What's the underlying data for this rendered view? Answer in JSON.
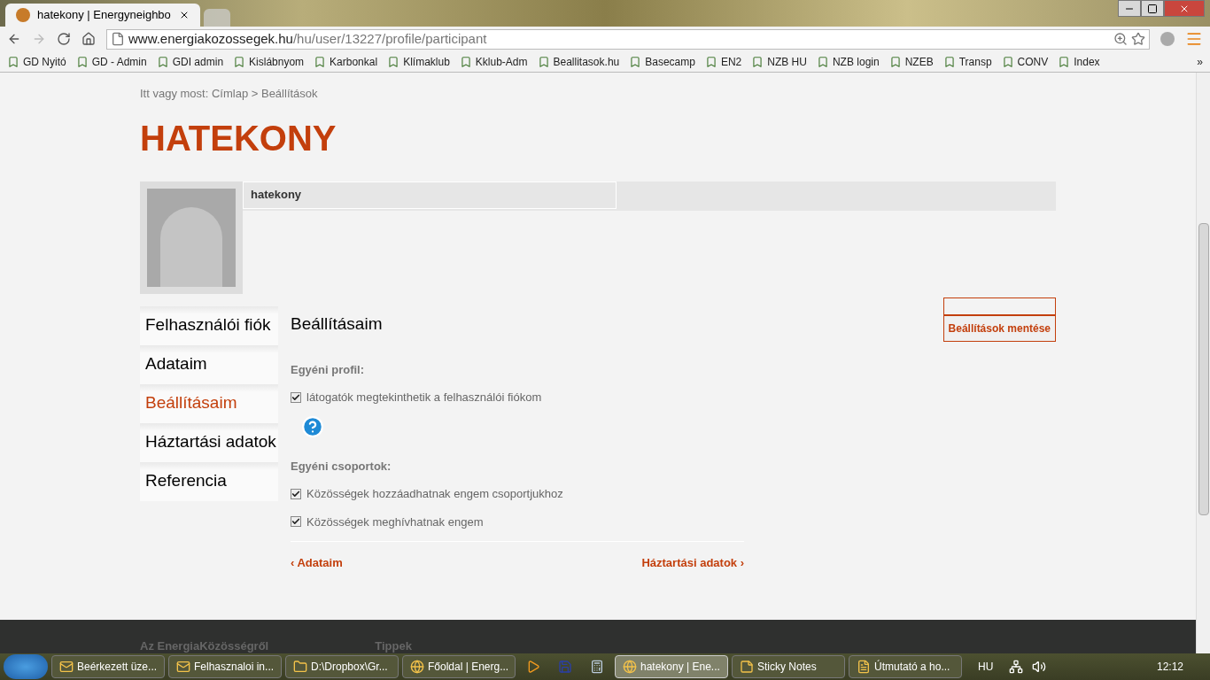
{
  "browser": {
    "tabs": [
      {
        "title": "hatekony | Energyneighbo",
        "selected": true
      },
      {
        "selected": false
      }
    ],
    "url_host": "www.energiakozossegek.hu",
    "url_path": "/hu/user/13227/profile/participant",
    "bookmarks": [
      {
        "label": "GD Nyitó"
      },
      {
        "label": "GD - Admin"
      },
      {
        "label": "GDI admin"
      },
      {
        "label": "Kislábnyom"
      },
      {
        "label": "Karbonkal"
      },
      {
        "label": "Klímaklub"
      },
      {
        "label": "Kklub-Adm"
      },
      {
        "label": "Beallitasok.hu"
      },
      {
        "label": "Basecamp"
      },
      {
        "label": "EN2"
      },
      {
        "label": "NZB HU"
      },
      {
        "label": "NZB login"
      },
      {
        "label": "NZEB"
      },
      {
        "label": "Transp"
      },
      {
        "label": "CONV"
      },
      {
        "label": "Index"
      }
    ],
    "bookmarks_more": "»"
  },
  "breadcrumb": {
    "prefix": "Itt vagy most:",
    "items": [
      "Címlap",
      "Beállítások"
    ],
    "separator": ">"
  },
  "page_title": "HATEKONY",
  "profile": {
    "username": "hatekony"
  },
  "side_menu": [
    {
      "label": "Felhasználói fiók",
      "selected": false
    },
    {
      "label": "Adataim",
      "selected": false
    },
    {
      "label": "Beállításaim",
      "selected": true
    },
    {
      "label": "Háztartási adatok",
      "selected": false
    },
    {
      "label": "Referencia",
      "selected": false
    }
  ],
  "settings": {
    "heading": "Beállításaim",
    "save_button": "Beállítások mentése",
    "sections": [
      {
        "title": "Egyéni profil:",
        "options": [
          {
            "label": "látogatók megtekinthetik a felhasználói fiókom",
            "checked": true
          }
        ],
        "help": true
      },
      {
        "title": "Egyéni csoportok:",
        "options": [
          {
            "label": "Közösségek hozzáadhatnak engem csoportjukhoz",
            "checked": true
          },
          {
            "label": "Közösségek meghívhatnak engem",
            "checked": true
          }
        ],
        "help": false
      }
    ],
    "prev_link": "‹ Adataim",
    "next_link": "Háztartási adatok ›"
  },
  "footer": {
    "headings": [
      "Az EnergiaKözösségről",
      "Tippek"
    ]
  },
  "taskbar": {
    "items": [
      {
        "label": "Beérkezett üze...",
        "selected": false
      },
      {
        "label": "Felhasznaloi in...",
        "selected": false
      },
      {
        "label": "D:\\Dropbox\\Gr...",
        "selected": false
      },
      {
        "label": "Főoldal | Energ...",
        "selected": false
      },
      {
        "label": "hatekony | Ene...",
        "selected": true
      },
      {
        "label": "Sticky Notes",
        "selected": false
      },
      {
        "label": "Útmutató a ho...",
        "selected": false
      }
    ],
    "language": "HU",
    "clock": "12:12"
  }
}
